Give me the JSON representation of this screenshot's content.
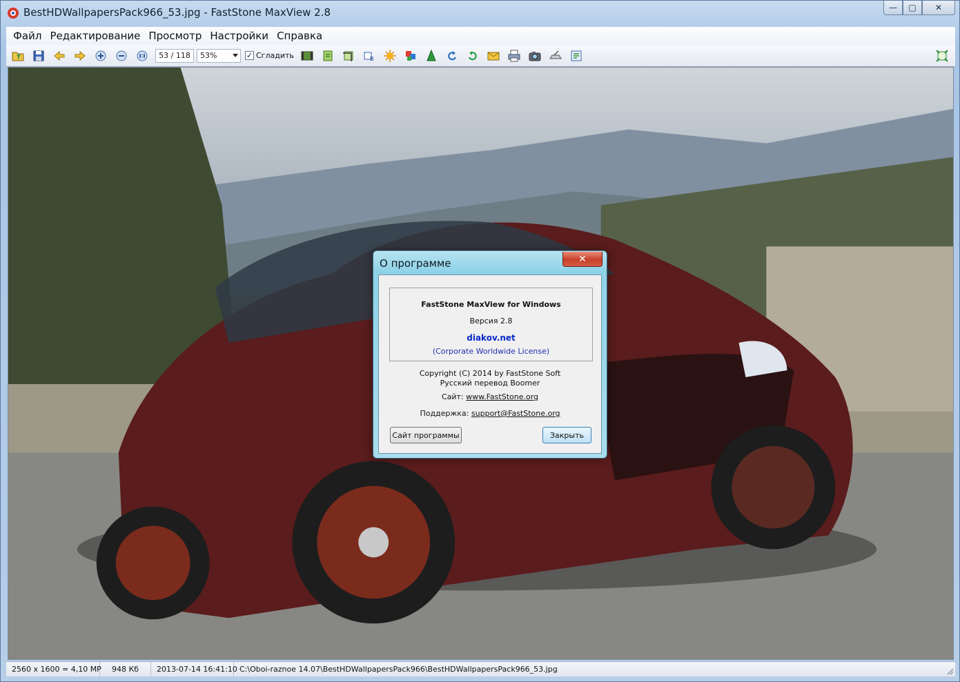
{
  "window": {
    "title": "BestHDWallpapersPack966_53.jpg - FastStone MaxView 2.8",
    "controls": {
      "minimize": "—",
      "maximize": "▢",
      "close": "✕"
    }
  },
  "menu": {
    "items": [
      "Файл",
      "Редактирование",
      "Просмотр",
      "Настройки",
      "Справка"
    ]
  },
  "toolbar": {
    "pager": "53 / 118",
    "zoom": "53%",
    "smooth_label": "Сгладить",
    "smooth_checked": "✓",
    "icons": [
      "open-folder-icon",
      "save-icon",
      "prev-arrow-icon",
      "next-arrow-icon",
      "zoom-in-icon",
      "zoom-out-icon",
      "actual-size-icon"
    ],
    "icons_right": [
      "slideshow-icon",
      "export-icon",
      "crop-icon",
      "rotate-left-icon",
      "effects-icon",
      "color-icon",
      "sharpen-icon",
      "rotate-ccw-icon",
      "rotate-cw-icon",
      "email-icon",
      "print-icon",
      "capture-icon",
      "scan-icon",
      "properties-icon"
    ]
  },
  "about_dialog": {
    "title": "О программе",
    "close_label": "✕",
    "product": "FastStone MaxView for Windows",
    "version": "Версия 2.8",
    "licensee": "diakov.net",
    "license": "(Corporate Worldwide License)",
    "copyright": "Copyright (C) 2014 by FastStone Soft",
    "translation": "Русский перевод  Boomer",
    "site_label": "Сайт:",
    "site_url": "www.FastStone.org",
    "support_label": "Поддержка:",
    "support_email": "support@FastStone.org",
    "site_button": "Сайт программы",
    "close_button": "Закрыть"
  },
  "statusbar": {
    "dimensions": "2560 x 1600 = 4,10 MP",
    "filesize": "948 Кб",
    "datetime": "2013-07-14 16:41:10",
    "path": "C:\\Oboi-raznoe 14.07\\BestHDWallpapersPack966\\BestHDWallpapersPack966_53.jpg"
  },
  "colors": {
    "frame": "#b7cee8",
    "dialog_frame": "#8fd2e8",
    "close_red": "#c7412b"
  }
}
